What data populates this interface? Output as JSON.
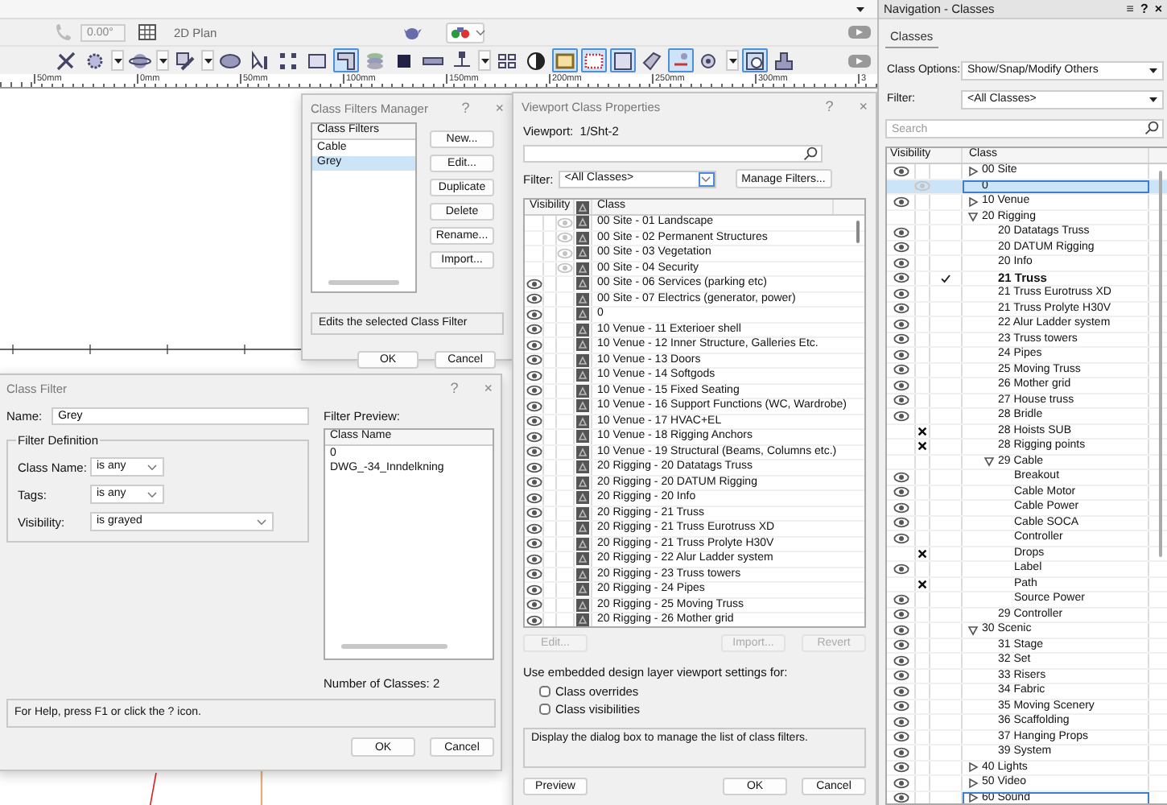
{
  "app": {
    "angle": "0.00°",
    "view": "2D Plan",
    "toolbar": [
      {
        "on": false
      },
      {
        "on": false
      },
      {
        "on": false
      },
      {
        "on": false
      },
      {
        "on": false
      },
      {
        "on": false
      },
      {
        "on": false
      },
      {
        "on": false
      },
      {
        "on": true
      },
      {
        "on": false
      },
      {
        "on": false
      },
      {
        "on": false
      },
      {
        "on": false
      },
      {
        "on": false
      },
      {
        "on": false
      },
      {
        "on": true
      },
      {
        "on": true
      },
      {
        "on": true
      },
      {
        "on": false
      },
      {
        "on": true
      },
      {
        "on": false
      },
      {
        "on": true
      },
      {
        "on": false
      }
    ],
    "ruler": [
      "50mm",
      "0mm",
      "50mm",
      "100mm",
      "150mm",
      "200mm",
      "250mm",
      "300mm",
      "3"
    ]
  },
  "class_filters_manager": {
    "title": "Class Filters Manager",
    "title_buttons": [
      "?",
      "×"
    ],
    "list_header": "Class Filters",
    "filters": [
      {
        "label": "Cable",
        "selected": false
      },
      {
        "label": "Grey",
        "selected": true
      }
    ],
    "buttons": [
      "New...",
      "Edit...",
      "Duplicate",
      "Delete",
      "Rename...",
      "Import..."
    ],
    "status": "Edits the selected Class Filter",
    "ok": "OK",
    "cancel": "Cancel"
  },
  "class_filter": {
    "title": "Class Filter",
    "title_buttons": [
      "?",
      "×"
    ],
    "name_label": "Name:",
    "name": "Grey",
    "group": "Filter Definition",
    "criteria": [
      {
        "label": "Class Name:",
        "value": "is any"
      },
      {
        "label": "Tags:",
        "value": "is any"
      },
      {
        "label": "Visibility:",
        "value": "is grayed"
      }
    ],
    "preview_label": "Filter Preview:",
    "preview_header": "Class Name",
    "preview": [
      "0",
      "DWG_-34_Inndelkning"
    ],
    "count": "Number of Classes: 2",
    "help": "For Help, press F1 or click the ? icon.",
    "ok": "OK",
    "cancel": "Cancel"
  },
  "viewport_class_properties": {
    "title": "Viewport Class Properties",
    "title_buttons": [
      "?",
      "×"
    ],
    "viewport": "Viewport:  1/Sht-2",
    "filter_label": "Filter:",
    "filter": "<All Classes>",
    "manage": "Manage Filters...",
    "columns": [
      "Visibility",
      "Class"
    ],
    "rows": [
      {
        "label": "00 Site - 01 Landscape",
        "visible": false,
        "grayed": true
      },
      {
        "label": "00 Site - 02 Permanent Structures",
        "visible": false,
        "grayed": true
      },
      {
        "label": "00 Site - 03 Vegetation",
        "visible": false,
        "grayed": true
      },
      {
        "label": "00 Site - 04 Security",
        "visible": false,
        "grayed": true
      },
      {
        "label": "00 Site - 06 Services (parking etc)",
        "visible": true,
        "grayed": false
      },
      {
        "label": "00 Site - 07 Electrics (generator, power)",
        "visible": true,
        "grayed": false
      },
      {
        "label": "0",
        "visible": true,
        "grayed": false
      },
      {
        "label": "10 Venue - 11 Exterioer shell",
        "visible": true,
        "grayed": false
      },
      {
        "label": "10 Venue - 12 Inner Structure, Galleries Etc.",
        "visible": true,
        "grayed": false
      },
      {
        "label": "10 Venue - 13 Doors",
        "visible": true,
        "grayed": false
      },
      {
        "label": "10 Venue - 14 Softgods",
        "visible": true,
        "grayed": false
      },
      {
        "label": "10 Venue - 15 Fixed Seating",
        "visible": true,
        "grayed": false
      },
      {
        "label": "10 Venue - 16 Support Functions (WC, Wardrobe)",
        "visible": true,
        "grayed": false
      },
      {
        "label": "10 Venue - 17 HVAC+EL",
        "visible": true,
        "grayed": false
      },
      {
        "label": "10 Venue - 18 Rigging Anchors",
        "visible": true,
        "grayed": false
      },
      {
        "label": "10 Venue - 19 Structural (Beams, Columns etc.)",
        "visible": true,
        "grayed": false
      },
      {
        "label": "20 Rigging - 20 Datatags Truss",
        "visible": true,
        "grayed": false
      },
      {
        "label": "20 Rigging - 20 DATUM Rigging",
        "visible": true,
        "grayed": false
      },
      {
        "label": "20 Rigging - 20 Info",
        "visible": true,
        "grayed": false
      },
      {
        "label": "20 Rigging - 21 Truss",
        "visible": true,
        "grayed": false
      },
      {
        "label": "20 Rigging - 21 Truss Eurotruss XD",
        "visible": true,
        "grayed": false
      },
      {
        "label": "20 Rigging - 21 Truss Prolyte H30V",
        "visible": true,
        "grayed": false
      },
      {
        "label": "20 Rigging - 22 Alur Ladder system",
        "visible": true,
        "grayed": false
      },
      {
        "label": "20 Rigging - 23 Truss towers",
        "visible": true,
        "grayed": false
      },
      {
        "label": "20 Rigging - 24 Pipes",
        "visible": true,
        "grayed": false
      },
      {
        "label": "20 Rigging - 25 Moving Truss",
        "visible": true,
        "grayed": false
      },
      {
        "label": "20 Rigging - 26 Mother grid",
        "visible": true,
        "grayed": false
      }
    ],
    "list_buttons": [
      {
        "label": "Edit...",
        "disabled": true
      },
      {
        "label": "Import...",
        "disabled": true
      },
      {
        "label": "Revert",
        "disabled": true
      }
    ],
    "embedded_label": "Use embedded design layer viewport settings for:",
    "checkboxes": [
      {
        "label": "Class overrides",
        "checked": false
      },
      {
        "label": "Class visibilities",
        "checked": false
      }
    ],
    "description": "Display the dialog box to manage the list of class filters.",
    "preview": "Preview",
    "ok": "OK",
    "cancel": "Cancel"
  },
  "navigation": {
    "title": "Navigation - Classes",
    "title_buttons": [
      "≡",
      "?",
      "×"
    ],
    "tabs": [
      {
        "label": "Classes",
        "selected": true
      }
    ],
    "class_options_label": "Class Options:",
    "class_options": "Show/Snap/Modify Others",
    "filter_label": "Filter:",
    "filter": "<All Classes>",
    "search_placeholder": "Search",
    "columns": [
      "Visibility",
      "Class"
    ],
    "tree": [
      {
        "label": "00 Site",
        "visible": true,
        "grayed": false,
        "hidden": false,
        "expanded": false,
        "selected": false,
        "active": false,
        "focused": false
      },
      {
        "label": "0",
        "visible": false,
        "grayed": true,
        "hidden": false,
        "selected": true,
        "active": false,
        "focused": true
      },
      {
        "label": "10 Venue",
        "visible": true,
        "grayed": false,
        "hidden": false,
        "expanded": false,
        "selected": false,
        "active": false,
        "focused": false
      },
      {
        "label": "20 Rigging",
        "visible": false,
        "grayed": false,
        "hidden": false,
        "expanded": true,
        "selected": false,
        "active": false,
        "focused": false,
        "children": [
          {
            "label": "20 Datatags Truss",
            "visible": true,
            "grayed": false,
            "hidden": false,
            "selected": false,
            "active": false,
            "focused": false
          },
          {
            "label": "20 DATUM Rigging",
            "visible": true,
            "grayed": false,
            "hidden": false,
            "selected": false,
            "active": false,
            "focused": false
          },
          {
            "label": "20 Info",
            "visible": true,
            "grayed": false,
            "hidden": false,
            "selected": false,
            "active": false,
            "focused": false
          },
          {
            "label": "21 Truss",
            "visible": true,
            "grayed": false,
            "hidden": false,
            "selected": false,
            "active": true,
            "focused": false
          },
          {
            "label": "21 Truss Eurotruss XD",
            "visible": true,
            "grayed": false,
            "hidden": false,
            "selected": false,
            "active": false,
            "focused": false
          },
          {
            "label": "21 Truss Prolyte H30V",
            "visible": true,
            "grayed": false,
            "hidden": false,
            "selected": false,
            "active": false,
            "focused": false
          },
          {
            "label": "22 Alur Ladder system",
            "visible": true,
            "grayed": false,
            "hidden": false,
            "selected": false,
            "active": false,
            "focused": false
          },
          {
            "label": "23 Truss towers",
            "visible": true,
            "grayed": false,
            "hidden": false,
            "selected": false,
            "active": false,
            "focused": false
          },
          {
            "label": "24 Pipes",
            "visible": true,
            "grayed": false,
            "hidden": false,
            "selected": false,
            "active": false,
            "focused": false
          },
          {
            "label": "25 Moving Truss",
            "visible": true,
            "grayed": false,
            "hidden": false,
            "selected": false,
            "active": false,
            "focused": false
          },
          {
            "label": "26 Mother grid",
            "visible": true,
            "grayed": false,
            "hidden": false,
            "selected": false,
            "active": false,
            "focused": false
          },
          {
            "label": "27 House truss",
            "visible": true,
            "grayed": false,
            "hidden": false,
            "selected": false,
            "active": false,
            "focused": false
          },
          {
            "label": "28 Bridle",
            "visible": true,
            "grayed": false,
            "hidden": false,
            "selected": false,
            "active": false,
            "focused": false
          },
          {
            "label": "28 Hoists SUB",
            "visible": false,
            "grayed": false,
            "hidden": true,
            "selected": false,
            "active": false,
            "focused": false
          },
          {
            "label": "28 Rigging points",
            "visible": false,
            "grayed": false,
            "hidden": true,
            "selected": false,
            "active": false,
            "focused": false
          },
          {
            "label": "29 Cable",
            "visible": false,
            "grayed": false,
            "hidden": false,
            "expanded": true,
            "selected": false,
            "active": false,
            "focused": false,
            "children": [
              {
                "label": "Breakout",
                "visible": true,
                "grayed": false,
                "hidden": false,
                "selected": false,
                "active": false,
                "focused": false
              },
              {
                "label": "Cable Motor",
                "visible": true,
                "grayed": false,
                "hidden": false,
                "selected": false,
                "active": false,
                "focused": false
              },
              {
                "label": "Cable Power",
                "visible": true,
                "grayed": false,
                "hidden": false,
                "selected": false,
                "active": false,
                "focused": false
              },
              {
                "label": "Cable SOCA",
                "visible": true,
                "grayed": false,
                "hidden": false,
                "selected": false,
                "active": false,
                "focused": false
              },
              {
                "label": "Controller",
                "visible": true,
                "grayed": false,
                "hidden": false,
                "selected": false,
                "active": false,
                "focused": false
              },
              {
                "label": "Drops",
                "visible": false,
                "grayed": false,
                "hidden": true,
                "selected": false,
                "active": false,
                "focused": false
              },
              {
                "label": "Label",
                "visible": true,
                "grayed": false,
                "hidden": false,
                "selected": false,
                "active": false,
                "focused": false
              },
              {
                "label": "Path",
                "visible": false,
                "grayed": false,
                "hidden": true,
                "selected": false,
                "active": false,
                "focused": false
              },
              {
                "label": "Source Power",
                "visible": true,
                "grayed": false,
                "hidden": false,
                "selected": false,
                "active": false,
                "focused": false
              }
            ]
          },
          {
            "label": "29 Controller",
            "visible": true,
            "grayed": false,
            "hidden": false,
            "selected": false,
            "active": false,
            "focused": false
          }
        ]
      },
      {
        "label": "30 Scenic",
        "visible": true,
        "grayed": false,
        "hidden": false,
        "expanded": true,
        "selected": false,
        "active": false,
        "focused": false,
        "children": [
          {
            "label": "31 Stage",
            "visible": true,
            "grayed": false,
            "hidden": false,
            "selected": false,
            "active": false,
            "focused": false
          },
          {
            "label": "32 Set",
            "visible": true,
            "grayed": false,
            "hidden": false,
            "selected": false,
            "active": false,
            "focused": false
          },
          {
            "label": "33 Risers",
            "visible": true,
            "grayed": false,
            "hidden": false,
            "selected": false,
            "active": false,
            "focused": false
          },
          {
            "label": "34 Fabric",
            "visible": true,
            "grayed": false,
            "hidden": false,
            "selected": false,
            "active": false,
            "focused": false
          },
          {
            "label": "35 Moving Scenery",
            "visible": true,
            "grayed": false,
            "hidden": false,
            "selected": false,
            "active": false,
            "focused": false
          },
          {
            "label": "36 Scaffolding",
            "visible": true,
            "grayed": false,
            "hidden": false,
            "selected": false,
            "active": false,
            "focused": false
          },
          {
            "label": "37 Hanging Props",
            "visible": true,
            "grayed": false,
            "hidden": false,
            "selected": false,
            "active": false,
            "focused": false
          },
          {
            "label": "39 System",
            "visible": true,
            "grayed": false,
            "hidden": false,
            "selected": false,
            "active": false,
            "focused": false
          }
        ]
      },
      {
        "label": "40 Lights",
        "visible": true,
        "grayed": false,
        "hidden": false,
        "expanded": false,
        "selected": false,
        "active": false,
        "focused": false
      },
      {
        "label": "50 Video",
        "visible": true,
        "grayed": false,
        "hidden": false,
        "expanded": false,
        "selected": false,
        "active": false,
        "focused": false
      },
      {
        "label": "60 Sound",
        "visible": true,
        "grayed": false,
        "hidden": false,
        "expanded": false,
        "selected": false,
        "active": false,
        "focused": true
      }
    ]
  }
}
